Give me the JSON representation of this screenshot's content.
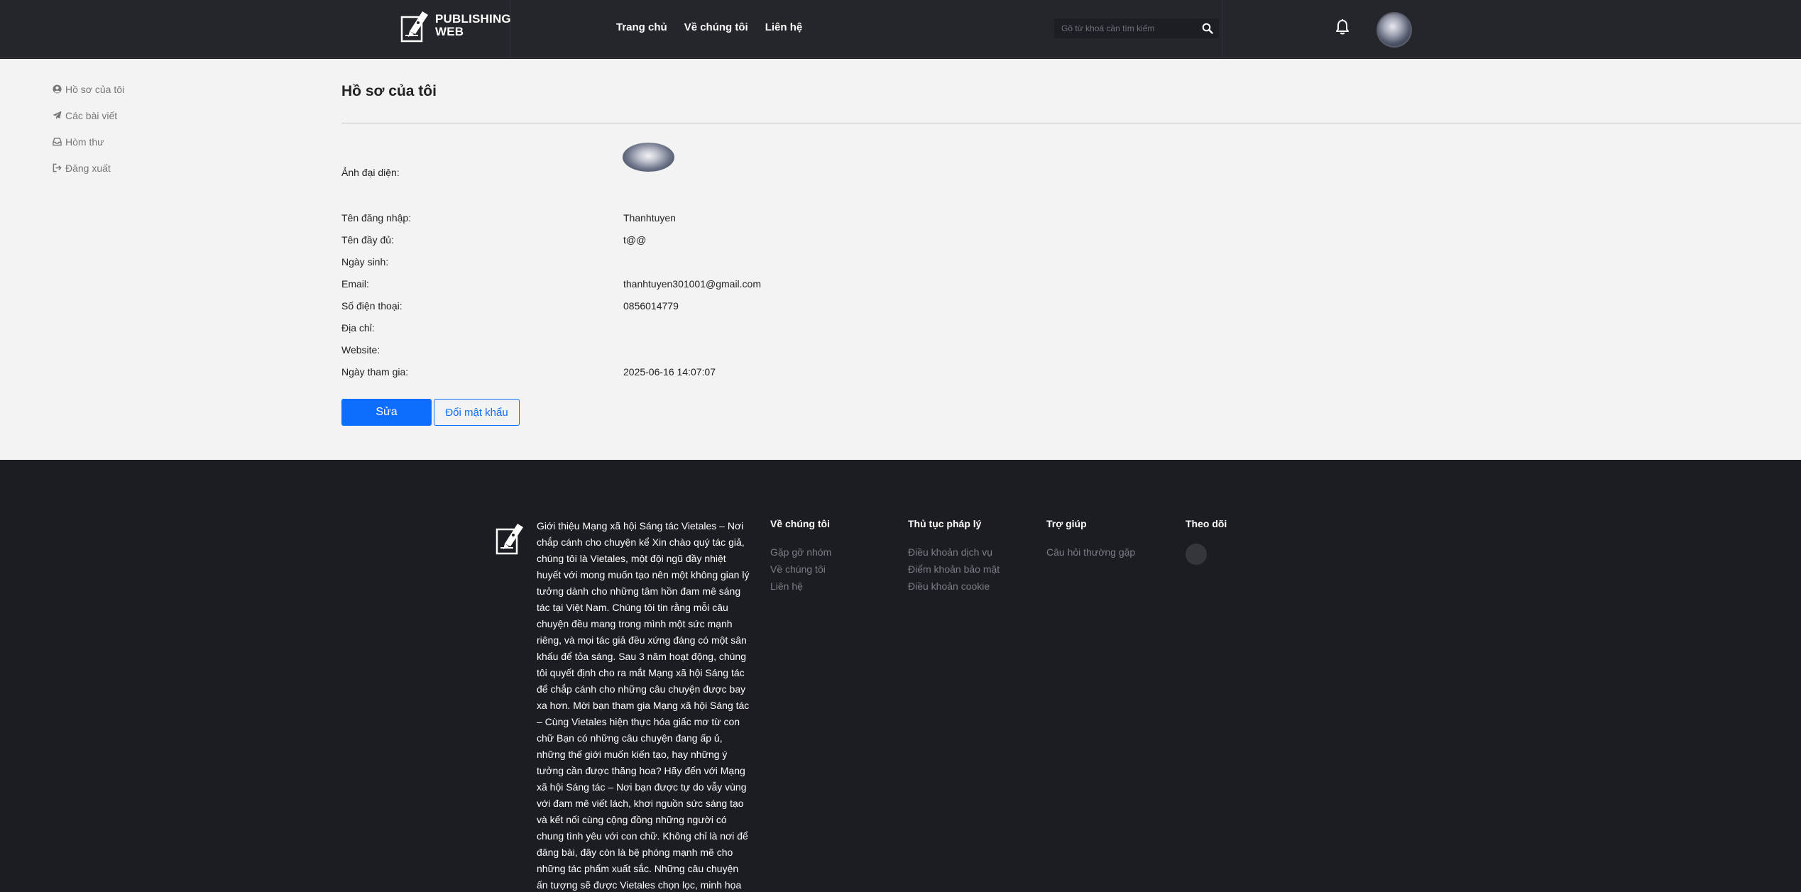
{
  "header": {
    "logo_line1": "PUBLISHING",
    "logo_line2": "WEB",
    "nav": [
      "Trang chủ",
      "Về chúng tôi",
      "Liên hệ"
    ],
    "search_placeholder": "Gõ từ khoá cần tìm kiếm"
  },
  "sidebar": {
    "items": [
      {
        "label": "Hồ sơ của tôi",
        "icon": "user-circle-icon"
      },
      {
        "label": "Các bài viết",
        "icon": "paper-plane-icon"
      },
      {
        "label": "Hòm thư",
        "icon": "inbox-icon"
      },
      {
        "label": "Đăng xuất",
        "icon": "sign-out-icon"
      }
    ]
  },
  "profile": {
    "title": "Hồ sơ của tôi",
    "avatar_label": "Ảnh đại diện:",
    "fields": [
      {
        "label": "Tên đăng nhập:",
        "value": "Thanhtuyen"
      },
      {
        "label": "Tên đầy đủ:",
        "value": "t@@"
      },
      {
        "label": "Ngày sinh:",
        "value": ""
      },
      {
        "label": "Email:",
        "value": "thanhtuyen301001@gmail.com"
      },
      {
        "label": "Số điện thoại:",
        "value": "0856014779"
      },
      {
        "label": "Địa chỉ:",
        "value": ""
      },
      {
        "label": "Website:",
        "value": ""
      },
      {
        "label": "Ngày tham gia:",
        "value": "2025-06-16 14:07:07"
      }
    ],
    "edit_label": "Sửa",
    "change_password_label": "Đổi mật khẩu"
  },
  "footer": {
    "about": "Giới thiệu Mạng xã hội Sáng tác Vietales – Nơi chắp cánh cho chuyện kể Xin chào quý tác giả, chúng tôi là Vietales, một đội ngũ đầy nhiệt huyết với mong muốn tạo nên một không gian lý tưởng dành cho những tâm hồn đam mê sáng tác tại Việt Nam. Chúng tôi tin rằng mỗi câu chuyện đều mang trong mình một sức mạnh riêng, và mọi tác giả đều xứng đáng có một sân khấu để tỏa sáng. Sau 3 năm hoạt động, chúng tôi quyết định cho ra mắt Mạng xã hội Sáng tác để chắp cánh cho những câu chuyện được bay xa hơn. Mời bạn tham gia Mạng xã hội Sáng tác – Cùng Vietales hiện thực hóa giấc mơ từ con chữ Bạn có những câu chuyện đang ấp ủ, những thế giới muốn kiến tạo, hay những ý tưởng cần được thăng hoa? Hãy đến với Mạng xã hội Sáng tác – Nơi bạn được tự do vẫy vùng với đam mê viết lách, khơi nguồn sức sáng tạo và kết nối cùng cộng đồng những người có chung tình yêu với con chữ. Không chỉ là nơi để đăng bài, đây còn là bệ phóng mạnh mẽ cho những tác phẩm xuất sắc. Những câu chuyện ấn tượng sẽ được Vietales chọn lọc, minh họa và đăng tải trực tiếp",
    "col1": {
      "title": "Về chúng tôi",
      "links": [
        "Gặp gỡ nhóm",
        "Về chúng tôi",
        "Liên hệ"
      ]
    },
    "col2": {
      "title": "Thủ tục pháp lý",
      "links": [
        "Điều khoản dịch vụ",
        "Điểm khoản bảo mật",
        "Điều khoản cookie"
      ]
    },
    "col3": {
      "title": "Trợ giúp",
      "links": [
        "Câu hỏi thường gặp"
      ]
    },
    "col4": {
      "title": "Theo dõi"
    }
  }
}
